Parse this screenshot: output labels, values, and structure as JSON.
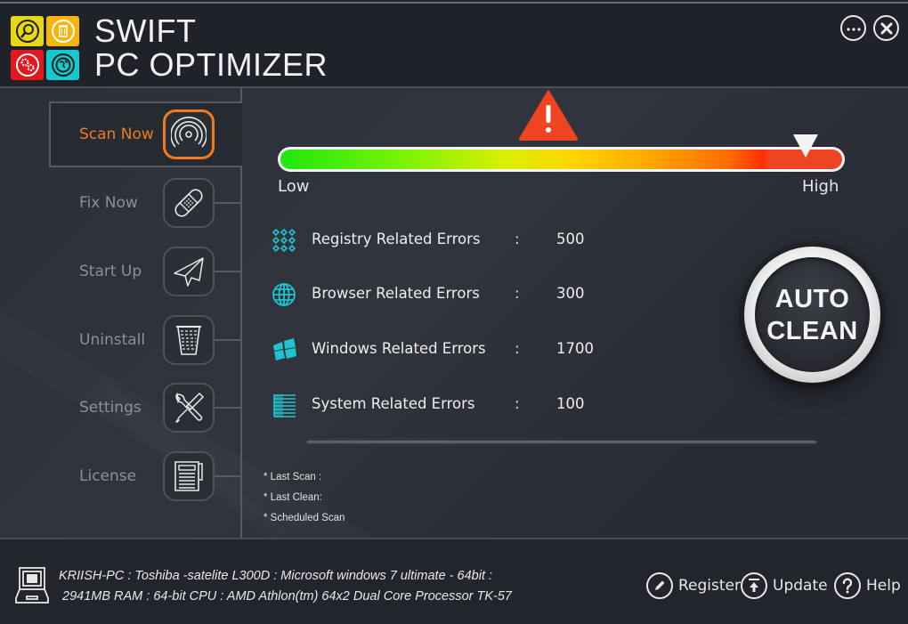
{
  "app": {
    "title_line1": "SWIFT",
    "title_line2": "PC OPTIMIZER",
    "logo_tiles": [
      {
        "icon": "search-refresh-icon",
        "color": "#e8d813"
      },
      {
        "icon": "trash-icon",
        "color": "#f6b40e"
      },
      {
        "icon": "gears-icon",
        "color": "#e4161e"
      },
      {
        "icon": "globe-icon",
        "color": "#15c9cf"
      }
    ]
  },
  "window_controls": {
    "more_label": "...",
    "close_label": "✕"
  },
  "sidebar": {
    "active_color": "#f07b20",
    "items": [
      {
        "label": "Scan Now",
        "icon": "scan-radar-icon",
        "active": true
      },
      {
        "label": "Fix Now",
        "icon": "bandage-icon",
        "active": false
      },
      {
        "label": "Start Up",
        "icon": "paper-plane-icon",
        "active": false
      },
      {
        "label": "Uninstall",
        "icon": "wastebasket-icon",
        "active": false
      },
      {
        "label": "Settings",
        "icon": "tools-icon",
        "active": false
      },
      {
        "label": "License",
        "icon": "document-icon",
        "active": false
      }
    ]
  },
  "severity_meter": {
    "low_label": "Low",
    "high_label": "High",
    "level": 0.95,
    "warning_icon": "warning-triangle-icon",
    "warning_color": "#ef4422"
  },
  "errors": [
    {
      "label": "Registry Related Errors",
      "separator": ":",
      "value": "500",
      "icon": "registry-icon"
    },
    {
      "label": "Browser Related Errors",
      "separator": ":",
      "value": "300",
      "icon": "globe-icon"
    },
    {
      "label": "Windows Related Errors",
      "separator": ":",
      "value": "1700",
      "icon": "windows-icon"
    },
    {
      "label": "System Related Errors",
      "separator": ":",
      "value": "100",
      "icon": "system-list-icon"
    }
  ],
  "accent_cyan": "#1fc3d0",
  "status": {
    "last_scan": "* Last Scan :",
    "last_clean": "* Last Clean:",
    "scheduled_scan": "* Scheduled Scan"
  },
  "auto_clean": {
    "line1": "AUTO",
    "line2": "CLEAN"
  },
  "footer": {
    "system_info_line1": "KRIISH-PC  : Toshiba -satelite L300D : Microsoft windows 7 ultimate - 64bit :",
    "system_info_line2": "2941MB RAM : 64-bit CPU : AMD Athlon(tm) 64x2 Dual Core Processor TK-57",
    "register_label": "Register",
    "update_label": "Update",
    "help_label": "Help"
  }
}
